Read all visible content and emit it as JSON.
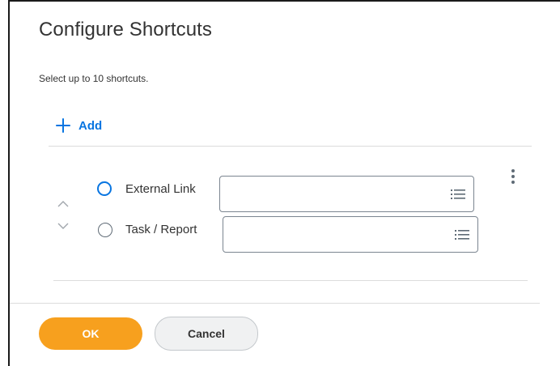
{
  "dialog": {
    "title": "Configure Shortcuts",
    "subtitle": "Select up to 10 shortcuts."
  },
  "add": {
    "label": "Add"
  },
  "shortcut": {
    "options": [
      {
        "label": "External Link",
        "selected": true,
        "input_value": ""
      },
      {
        "label": "Task / Report",
        "selected": false,
        "input_value": ""
      }
    ],
    "icons": {
      "move_up": "chevron-up-icon",
      "move_down": "chevron-down-icon",
      "prompt": "list-icon",
      "menu": "kebab-menu-icon"
    }
  },
  "footer": {
    "ok_label": "OK",
    "cancel_label": "Cancel"
  },
  "colors": {
    "accent_blue": "#0875e1",
    "ok_orange": "#f7a01e",
    "cancel_bg": "#f0f1f2"
  }
}
